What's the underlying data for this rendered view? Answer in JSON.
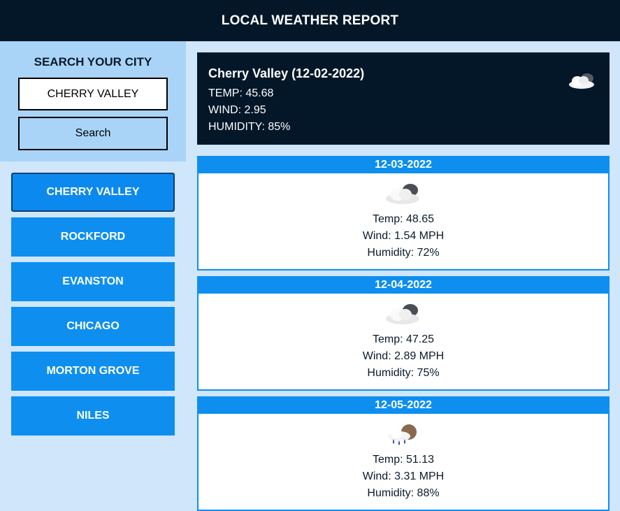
{
  "header": {
    "title": "LOCAL WEATHER REPORT"
  },
  "search": {
    "title": "SEARCH YOUR CITY",
    "input_value": "CHERRY VALLEY",
    "button_label": "Search"
  },
  "cities": [
    "CHERRY VALLEY",
    "ROCKFORD",
    "EVANSTON",
    "CHICAGO",
    "MORTON GROVE",
    "NILES"
  ],
  "current": {
    "title": "Cherry Valley (12-02-2022)",
    "temp": "TEMP: 45.68",
    "wind": "WIND: 2.95",
    "humidity": "HUMIDITY: 85%",
    "icon": "cloud-icon"
  },
  "forecast": [
    {
      "date": "12-03-2022",
      "icon": "cloudy-icon",
      "temp": "Temp: 48.65",
      "wind": "Wind: 1.54 MPH",
      "humidity": "Humidity: 72%"
    },
    {
      "date": "12-04-2022",
      "icon": "cloudy-icon",
      "temp": "Temp: 47.25",
      "wind": "Wind: 2.89 MPH",
      "humidity": "Humidity: 75%"
    },
    {
      "date": "12-05-2022",
      "icon": "rain-icon",
      "temp": "Temp: 51.13",
      "wind": "Wind: 3.31 MPH",
      "humidity": "Humidity: 88%"
    }
  ],
  "colors": {
    "accent": "#0e8ff0",
    "dark": "#031729",
    "panel": "#a9d4f8",
    "background": "#d0e6fb"
  }
}
